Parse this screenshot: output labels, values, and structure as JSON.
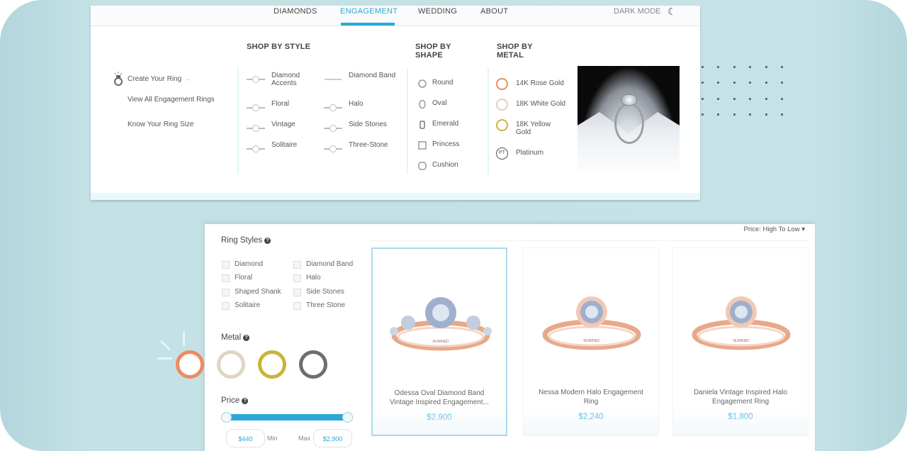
{
  "top_nav": {
    "items": [
      {
        "label": "DIAMONDS",
        "active": false
      },
      {
        "label": "ENGAGEMENT",
        "active": true
      },
      {
        "label": "WEDDING",
        "active": false
      },
      {
        "label": "ABOUT",
        "active": false
      }
    ],
    "dark_mode_label": "DARK MODE",
    "dark_mode_icon": "moon-icon",
    "accent_color": "#2aa8d8"
  },
  "mega_menu": {
    "quick_links": [
      {
        "label": "Create Your Ring",
        "icon": "ring-sparkle-icon",
        "trailing_icon": "arrow-right-icon"
      },
      {
        "label": "View All Engagement Rings"
      },
      {
        "label": "Know Your Ring Size"
      }
    ],
    "shop_by_style": {
      "heading": "SHOP BY STYLE",
      "items": [
        {
          "label": "Diamond Accents",
          "icon": "diamond-accents-ring-icon"
        },
        {
          "label": "Diamond Band",
          "icon": "diamond-band-icon"
        },
        {
          "label": "Floral",
          "icon": "floral-ring-icon"
        },
        {
          "label": "Halo",
          "icon": "halo-ring-icon"
        },
        {
          "label": "Vintage",
          "icon": "vintage-ring-icon"
        },
        {
          "label": "Side Stones",
          "icon": "side-stones-ring-icon"
        },
        {
          "label": "Solitaire",
          "icon": "solitaire-ring-icon"
        },
        {
          "label": "Three-Stone",
          "icon": "three-stone-ring-icon"
        }
      ]
    },
    "shop_by_shape": {
      "heading_line1": "SHOP BY",
      "heading_line2": "SHAPE",
      "items": [
        {
          "label": "Round",
          "icon": "round-shape-icon"
        },
        {
          "label": "Oval",
          "icon": "oval-shape-icon"
        },
        {
          "label": "Emerald",
          "icon": "emerald-shape-icon"
        },
        {
          "label": "Princess",
          "icon": "princess-shape-icon"
        },
        {
          "label": "Cushion",
          "icon": "cushion-shape-icon"
        }
      ]
    },
    "shop_by_metal": {
      "heading_line1": "SHOP BY",
      "heading_line2": "METAL",
      "items": [
        {
          "label_line1": "14K Rose Gold",
          "label_line2": "",
          "color": "#f08a5d"
        },
        {
          "label_line1": "18K White Gold",
          "label_line2": "",
          "color": "#dcd3bd"
        },
        {
          "label_line1": "18K Yellow",
          "label_line2": "Gold",
          "color": "#d2b33c"
        },
        {
          "label_line1": "Platinum",
          "label_line2": "",
          "badge": "PT",
          "color": "#555555"
        }
      ]
    },
    "promo_image": "ring-on-satin-photo"
  },
  "filters": {
    "ring_styles": {
      "title": "Ring Styles",
      "options": [
        {
          "label": "Diamond",
          "checked": false
        },
        {
          "label": "Diamond Band",
          "checked": false
        },
        {
          "label": "Floral",
          "checked": false
        },
        {
          "label": "Halo",
          "checked": false
        },
        {
          "label": "Shaped Shank",
          "checked": false
        },
        {
          "label": "Side Stones",
          "checked": false
        },
        {
          "label": "Solitaire",
          "checked": false
        },
        {
          "label": "Three Stone",
          "checked": false
        }
      ]
    },
    "metal": {
      "title": "Metal",
      "swatches": [
        {
          "name": "rose-gold",
          "color": "#f08a5d",
          "selected": true
        },
        {
          "name": "white-gold",
          "color": "#ddd6c1",
          "selected": false
        },
        {
          "name": "yellow-gold",
          "color": "#c9b43a",
          "selected": false
        },
        {
          "name": "platinum",
          "color": "#6e6e6e",
          "selected": false
        }
      ]
    },
    "price": {
      "title": "Price",
      "min_value": "$440",
      "max_value": "$2,900",
      "min_label": "Min",
      "max_label": "Max",
      "range_fraction": [
        0,
        1
      ]
    },
    "help_icon": "?"
  },
  "listing": {
    "sort_label": "Price: High To Low",
    "sort_icon": "caret-down-icon",
    "products": [
      {
        "name_line1": "Odessa Oval Diamond Band",
        "name_line2": "Vintage Inspired Engagement...",
        "price": "$2,900",
        "selected": true,
        "style": "side-stones"
      },
      {
        "name_line1": "Nessa Modern Halo Engagement",
        "name_line2": "Ring",
        "price": "$2,240",
        "selected": false,
        "style": "halo"
      },
      {
        "name_line1": "Daniela Vintage Inspired Halo",
        "name_line2": "Engagement Ring",
        "price": "$1,800",
        "selected": false,
        "style": "vintage-halo"
      }
    ]
  }
}
